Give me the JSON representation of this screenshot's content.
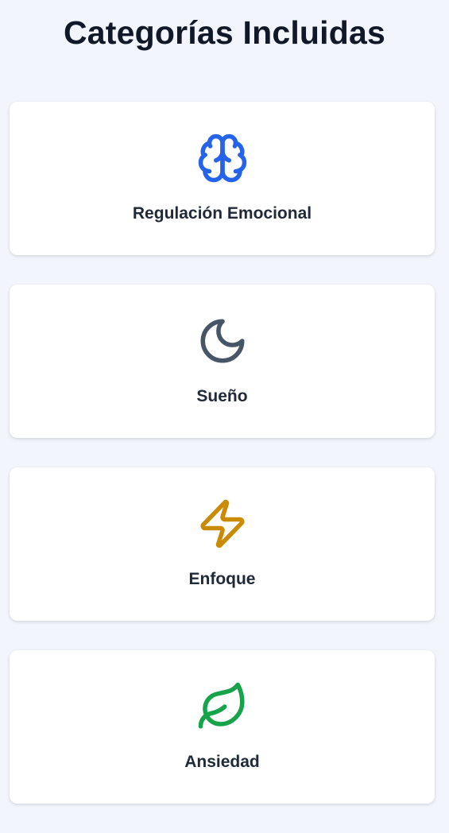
{
  "header": {
    "title": "Categorías Incluidas"
  },
  "categories": [
    {
      "label": "Regulación Emocional",
      "icon": "brain-icon",
      "color": "#2563eb"
    },
    {
      "label": "Sueño",
      "icon": "moon-icon",
      "color": "#475569"
    },
    {
      "label": "Enfoque",
      "icon": "lightning-icon",
      "color": "#ca8a04"
    },
    {
      "label": "Ansiedad",
      "icon": "leaf-icon",
      "color": "#16a34a"
    }
  ]
}
